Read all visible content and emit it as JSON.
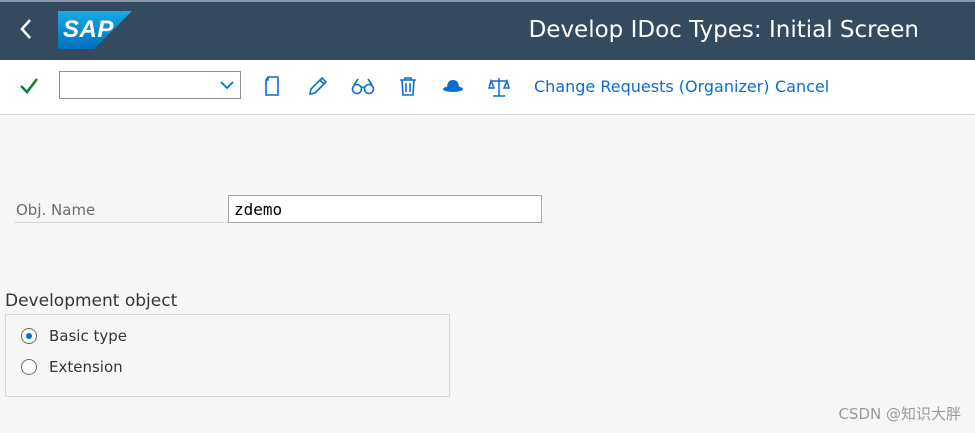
{
  "header": {
    "logo_text": "SAP",
    "title": "Develop IDoc Types: Initial Screen",
    "back_icon": "chevron-left-icon"
  },
  "toolbar": {
    "command_field_value": "",
    "icons": [
      "checkmark-icon",
      "copy-icon",
      "edit-icon",
      "display-icon",
      "delete-icon",
      "hat-icon",
      "balance-icon"
    ],
    "change_requests_label": "Change Requests (Organizer)",
    "cancel_label": "Cancel"
  },
  "form": {
    "obj_name_label": "Obj. Name",
    "obj_name_value": "zdemo"
  },
  "development_object": {
    "title": "Development object",
    "options": [
      {
        "label": "Basic type",
        "selected": true
      },
      {
        "label": "Extension",
        "selected": false
      }
    ]
  },
  "watermark": "CSDN @知识大胖",
  "colors": {
    "header_bg": "#354a5f",
    "accent": "#0a6ed1",
    "check": "#107e3e"
  }
}
